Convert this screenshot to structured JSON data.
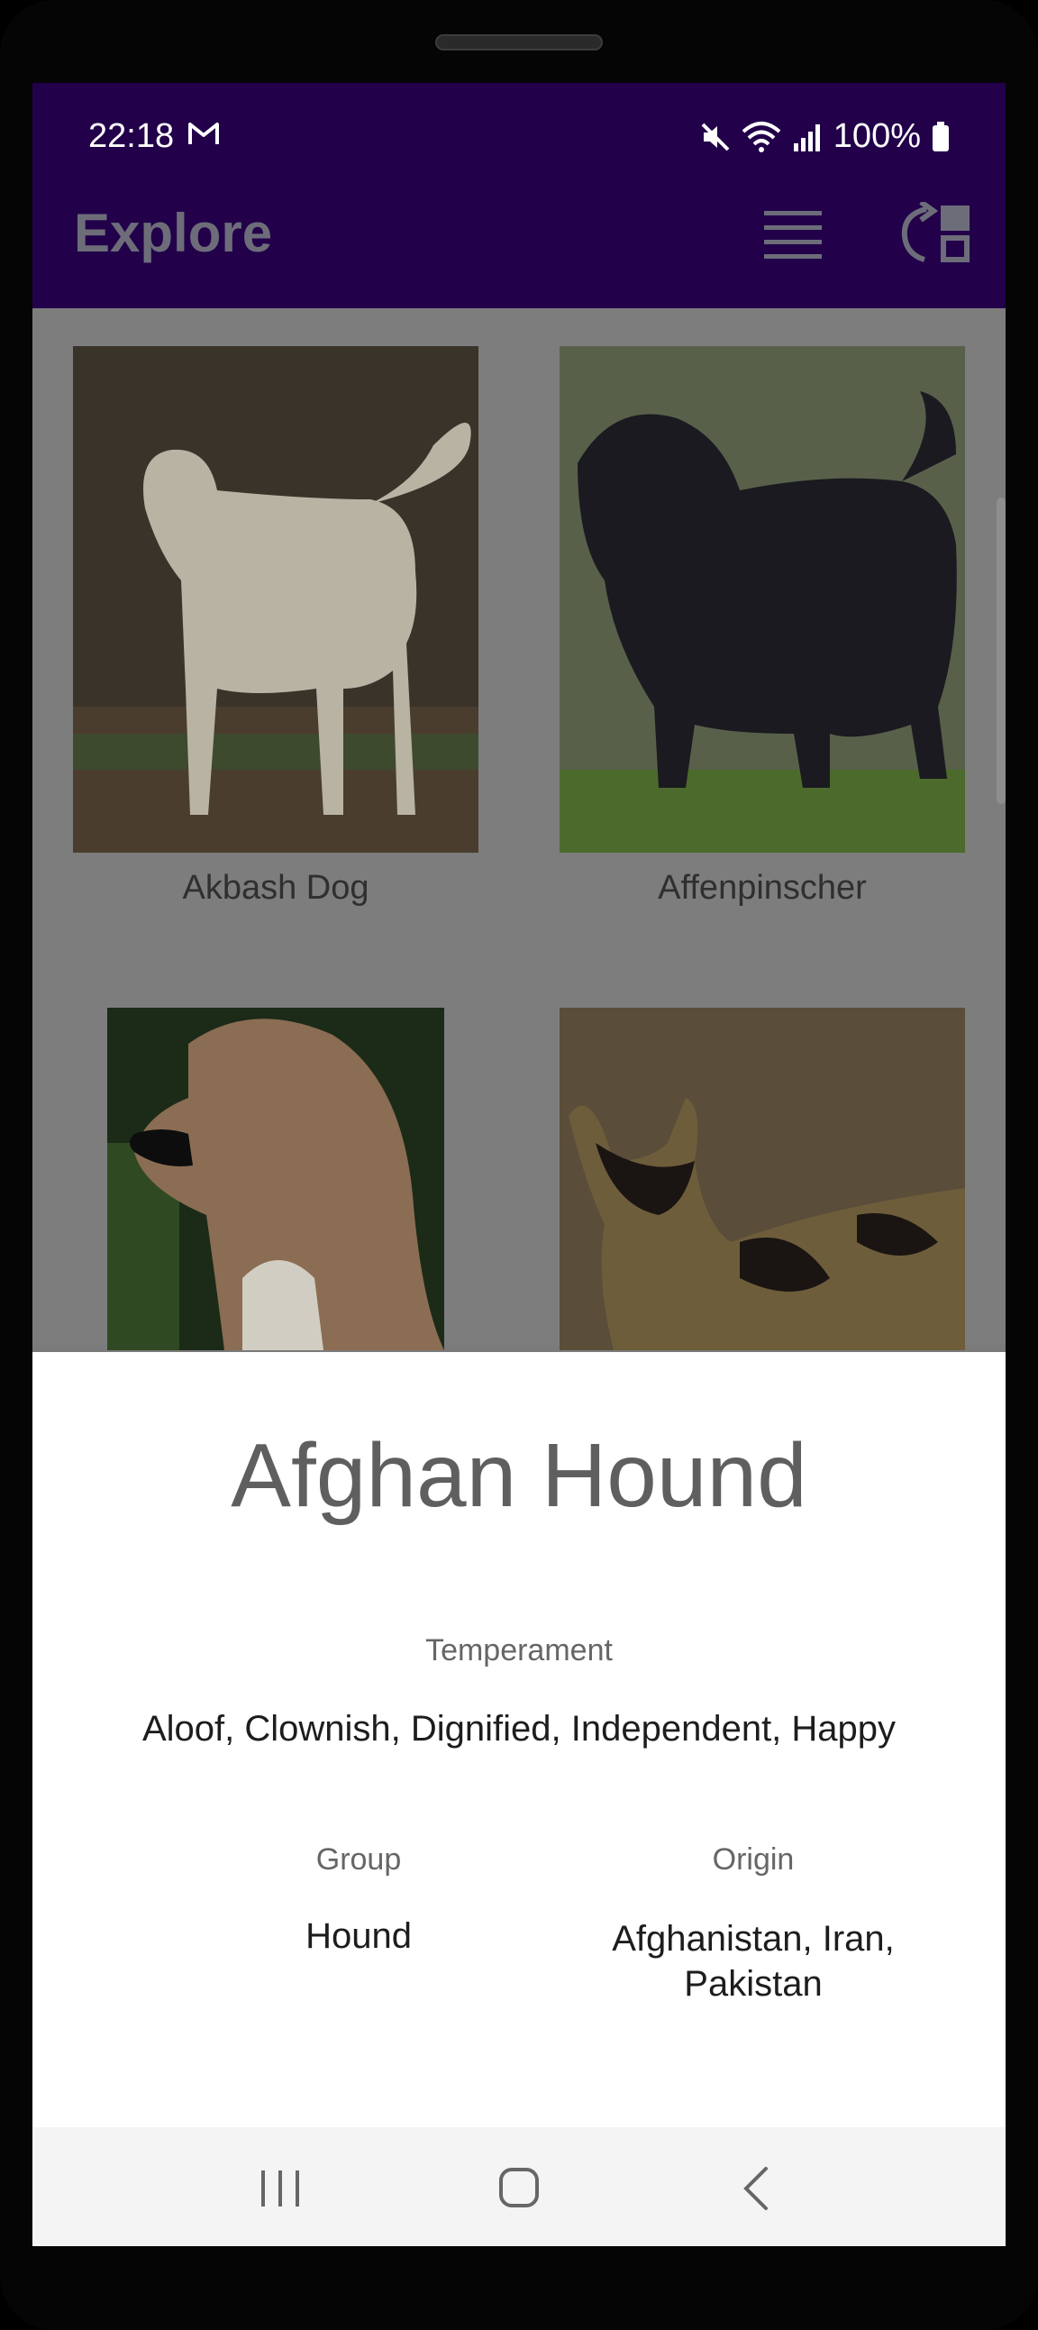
{
  "status_bar": {
    "time": "22:18",
    "battery": "100%",
    "icons": [
      "gmail-icon",
      "mute-icon",
      "wifi-icon",
      "signal-icon",
      "battery-icon"
    ]
  },
  "app_bar": {
    "title": "Explore",
    "actions": [
      "list-view-icon",
      "swap-layout-icon"
    ]
  },
  "grid": {
    "items": [
      {
        "label": "Akbash Dog"
      },
      {
        "label": "Affenpinscher"
      },
      {
        "label": ""
      },
      {
        "label": ""
      }
    ]
  },
  "detail": {
    "name": "Afghan Hound",
    "temperament_label": "Temperament",
    "temperament": "Aloof, Clownish, Dignified, Independent, Happy",
    "group_label": "Group",
    "group": "Hound",
    "origin_label": "Origin",
    "origin": "Afghanistan, Iran, Pakistan"
  },
  "nav_bar": {
    "buttons": [
      "recents-icon",
      "home-icon",
      "back-icon"
    ]
  },
  "colors": {
    "app_bar": "#22004a",
    "scrim": "#7d7d7d",
    "sheet": "#ffffff"
  }
}
